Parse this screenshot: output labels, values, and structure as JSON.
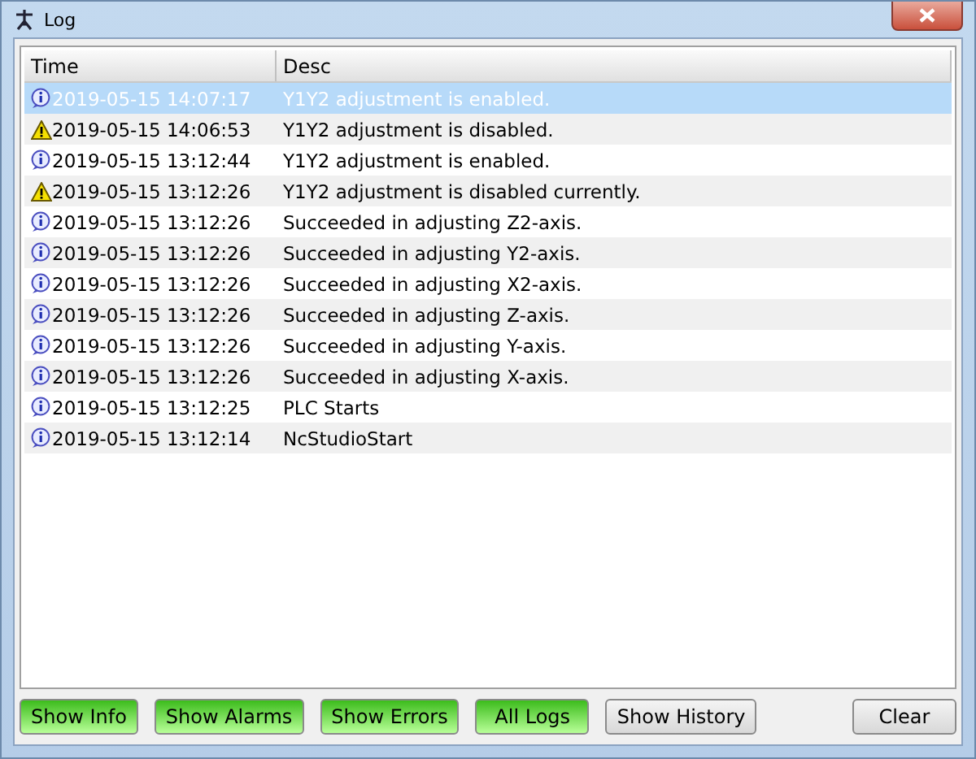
{
  "window": {
    "title": "Log"
  },
  "table": {
    "columns": [
      "Time",
      "Desc"
    ],
    "rows": [
      {
        "kind": "info",
        "time": "2019-05-15 14:07:17",
        "desc": "Y1Y2 adjustment is enabled.",
        "selected": true
      },
      {
        "kind": "alarm",
        "time": "2019-05-15 14:06:53",
        "desc": "Y1Y2 adjustment is disabled.",
        "selected": false
      },
      {
        "kind": "info",
        "time": "2019-05-15 13:12:44",
        "desc": "Y1Y2 adjustment is enabled.",
        "selected": false
      },
      {
        "kind": "alarm",
        "time": "2019-05-15 13:12:26",
        "desc": "Y1Y2 adjustment is disabled currently.",
        "selected": false
      },
      {
        "kind": "info",
        "time": "2019-05-15 13:12:26",
        "desc": "Succeeded in adjusting Z2-axis.",
        "selected": false
      },
      {
        "kind": "info",
        "time": "2019-05-15 13:12:26",
        "desc": "Succeeded in adjusting Y2-axis.",
        "selected": false
      },
      {
        "kind": "info",
        "time": "2019-05-15 13:12:26",
        "desc": "Succeeded in adjusting X2-axis.",
        "selected": false
      },
      {
        "kind": "info",
        "time": "2019-05-15 13:12:26",
        "desc": "Succeeded in adjusting Z-axis.",
        "selected": false
      },
      {
        "kind": "info",
        "time": "2019-05-15 13:12:26",
        "desc": "Succeeded in adjusting Y-axis.",
        "selected": false
      },
      {
        "kind": "info",
        "time": "2019-05-15 13:12:26",
        "desc": "Succeeded in adjusting X-axis.",
        "selected": false
      },
      {
        "kind": "info",
        "time": "2019-05-15 13:12:25",
        "desc": "PLC Starts",
        "selected": false
      },
      {
        "kind": "info",
        "time": "2019-05-15 13:12:14",
        "desc": "NcStudioStart",
        "selected": false
      }
    ]
  },
  "filter_buttons": [
    {
      "label": "Show Info",
      "on": true
    },
    {
      "label": "Show Alarms",
      "on": true
    },
    {
      "label": "Show Errors",
      "on": true
    },
    {
      "label": "All Logs",
      "on": true
    },
    {
      "label": "Show History",
      "on": false
    }
  ],
  "clear_button": {
    "label": "Clear"
  }
}
